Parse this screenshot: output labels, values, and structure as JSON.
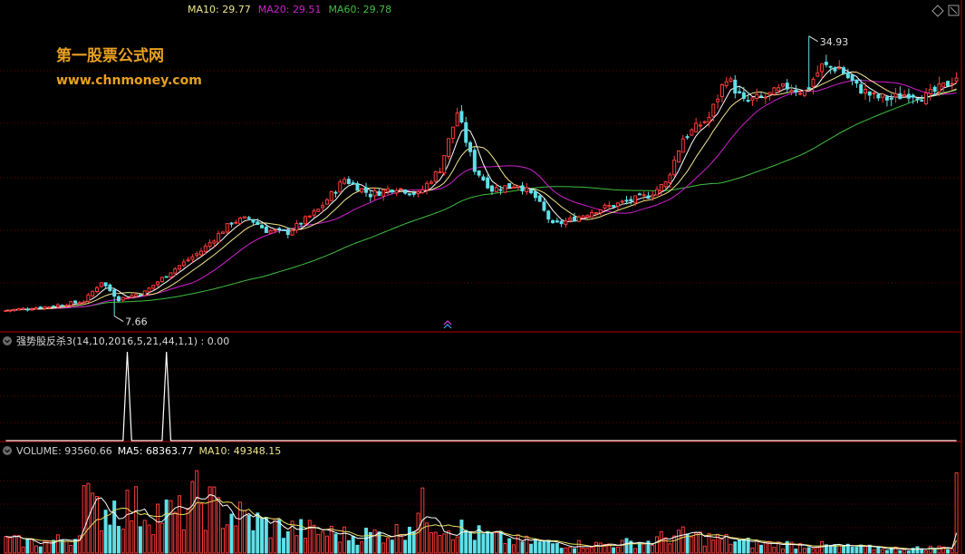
{
  "watermark": {
    "title": "第一股票公式网",
    "url": "www.chnmoney.com"
  },
  "colors": {
    "up": "#ff3b3b",
    "down": "#5fe0e8",
    "ma5": "#ffffff",
    "ma10": "#f0e68c",
    "ma20": "#d020d0",
    "ma60": "#3fbf3f",
    "frame": "#b00000",
    "indicator_line": "#ffffff",
    "vol_ma5": "#ffffff",
    "vol_ma10": "#e8e060"
  },
  "icons": {
    "panel_toggle": "chevron-down-circle-icon",
    "top_right_1": "diamond-outline-icon",
    "top_right_2": "square-outline-icon",
    "mid_marker": "double-chevron-up-icon"
  },
  "price_panel": {
    "legend": [
      {
        "label": "MA10: ",
        "value": "29.77",
        "color": "#f0e68c"
      },
      {
        "label": "MA20: ",
        "value": "29.51",
        "color": "#d020d0"
      },
      {
        "label": "MA60: ",
        "value": "29.78",
        "color": "#3fbf3f"
      }
    ],
    "high_label": "34.93",
    "low_label": "7.66"
  },
  "indicator_panel": {
    "title": "强势股反杀3(14,10,2016,5,21,44,1,1) : 0.00"
  },
  "volume_panel": {
    "legend": [
      {
        "label": "VOLUME: ",
        "value": "93560.66",
        "color": "#d0d0d0"
      },
      {
        "label": "MA5: ",
        "value": "68363.77",
        "color": "#ffffff"
      },
      {
        "label": "MA10: ",
        "value": "49348.15",
        "color": "#f0e68c"
      }
    ]
  },
  "chart_data": [
    {
      "type": "candlestick",
      "name": "price",
      "ylim": [
        7.0,
        36.5
      ],
      "grid": true,
      "keypoints": [
        [
          0,
          8.2
        ],
        [
          10,
          8.6
        ],
        [
          18,
          9.1
        ],
        [
          22,
          11.0
        ],
        [
          26,
          9.3
        ],
        [
          32,
          10.0
        ],
        [
          38,
          12.0
        ],
        [
          45,
          14.0
        ],
        [
          52,
          16.8
        ],
        [
          56,
          17.2
        ],
        [
          60,
          16.0
        ],
        [
          65,
          15.8
        ],
        [
          72,
          18.0
        ],
        [
          78,
          21.0
        ],
        [
          84,
          19.5
        ],
        [
          90,
          20.2
        ],
        [
          95,
          19.5
        ],
        [
          100,
          22.0
        ],
        [
          104,
          27.5
        ],
        [
          108,
          22.0
        ],
        [
          112,
          20.0
        ],
        [
          118,
          20.5
        ],
        [
          122,
          19.2
        ],
        [
          126,
          16.5
        ],
        [
          130,
          17.0
        ],
        [
          136,
          18.0
        ],
        [
          142,
          18.7
        ],
        [
          148,
          19.4
        ],
        [
          152,
          20.6
        ],
        [
          156,
          25.0
        ],
        [
          162,
          27.0
        ],
        [
          166,
          31.0
        ],
        [
          170,
          28.5
        ],
        [
          175,
          29.0
        ],
        [
          180,
          30.0
        ],
        [
          184,
          29.5
        ],
        [
          188,
          32.0
        ],
        [
          192,
          31.8
        ],
        [
          196,
          30.0
        ],
        [
          200,
          29.0
        ],
        [
          204,
          28.8
        ],
        [
          208,
          29.4
        ],
        [
          212,
          29.0
        ],
        [
          216,
          30.0
        ],
        [
          219,
          31.0
        ]
      ],
      "high": {
        "value": 34.93,
        "index": 185
      },
      "low": {
        "value": 7.66,
        "index": 25
      },
      "ma": [
        {
          "name": "MA10",
          "value": 29.77
        },
        {
          "name": "MA20",
          "value": 29.51
        },
        {
          "name": "MA60",
          "value": 29.78
        }
      ]
    },
    {
      "type": "line",
      "name": "强势股反杀3",
      "ylim": [
        0,
        1
      ],
      "signals": [
        {
          "index": 28,
          "value": 1
        },
        {
          "index": 37,
          "value": 1
        }
      ],
      "current": 0.0
    },
    {
      "type": "bar",
      "name": "VOLUME",
      "ylim": [
        0,
        110000
      ],
      "current": 93560.66,
      "ma5": 68363.77,
      "ma10": 49348.15,
      "envelope": [
        [
          0,
          18000
        ],
        [
          8,
          15000
        ],
        [
          16,
          22000
        ],
        [
          18,
          90000
        ],
        [
          20,
          60000
        ],
        [
          26,
          70000
        ],
        [
          32,
          62000
        ],
        [
          40,
          55000
        ],
        [
          44,
          78000
        ],
        [
          50,
          60000
        ],
        [
          56,
          48000
        ],
        [
          62,
          38000
        ],
        [
          70,
          32000
        ],
        [
          80,
          25000
        ],
        [
          90,
          30000
        ],
        [
          96,
          62000
        ],
        [
          100,
          45000
        ],
        [
          108,
          28000
        ],
        [
          116,
          18000
        ],
        [
          126,
          14000
        ],
        [
          136,
          12000
        ],
        [
          148,
          16000
        ],
        [
          154,
          26000
        ],
        [
          162,
          22000
        ],
        [
          172,
          14000
        ],
        [
          184,
          12000
        ],
        [
          196,
          8000
        ],
        [
          208,
          6000
        ],
        [
          219,
          9000
        ]
      ]
    }
  ]
}
